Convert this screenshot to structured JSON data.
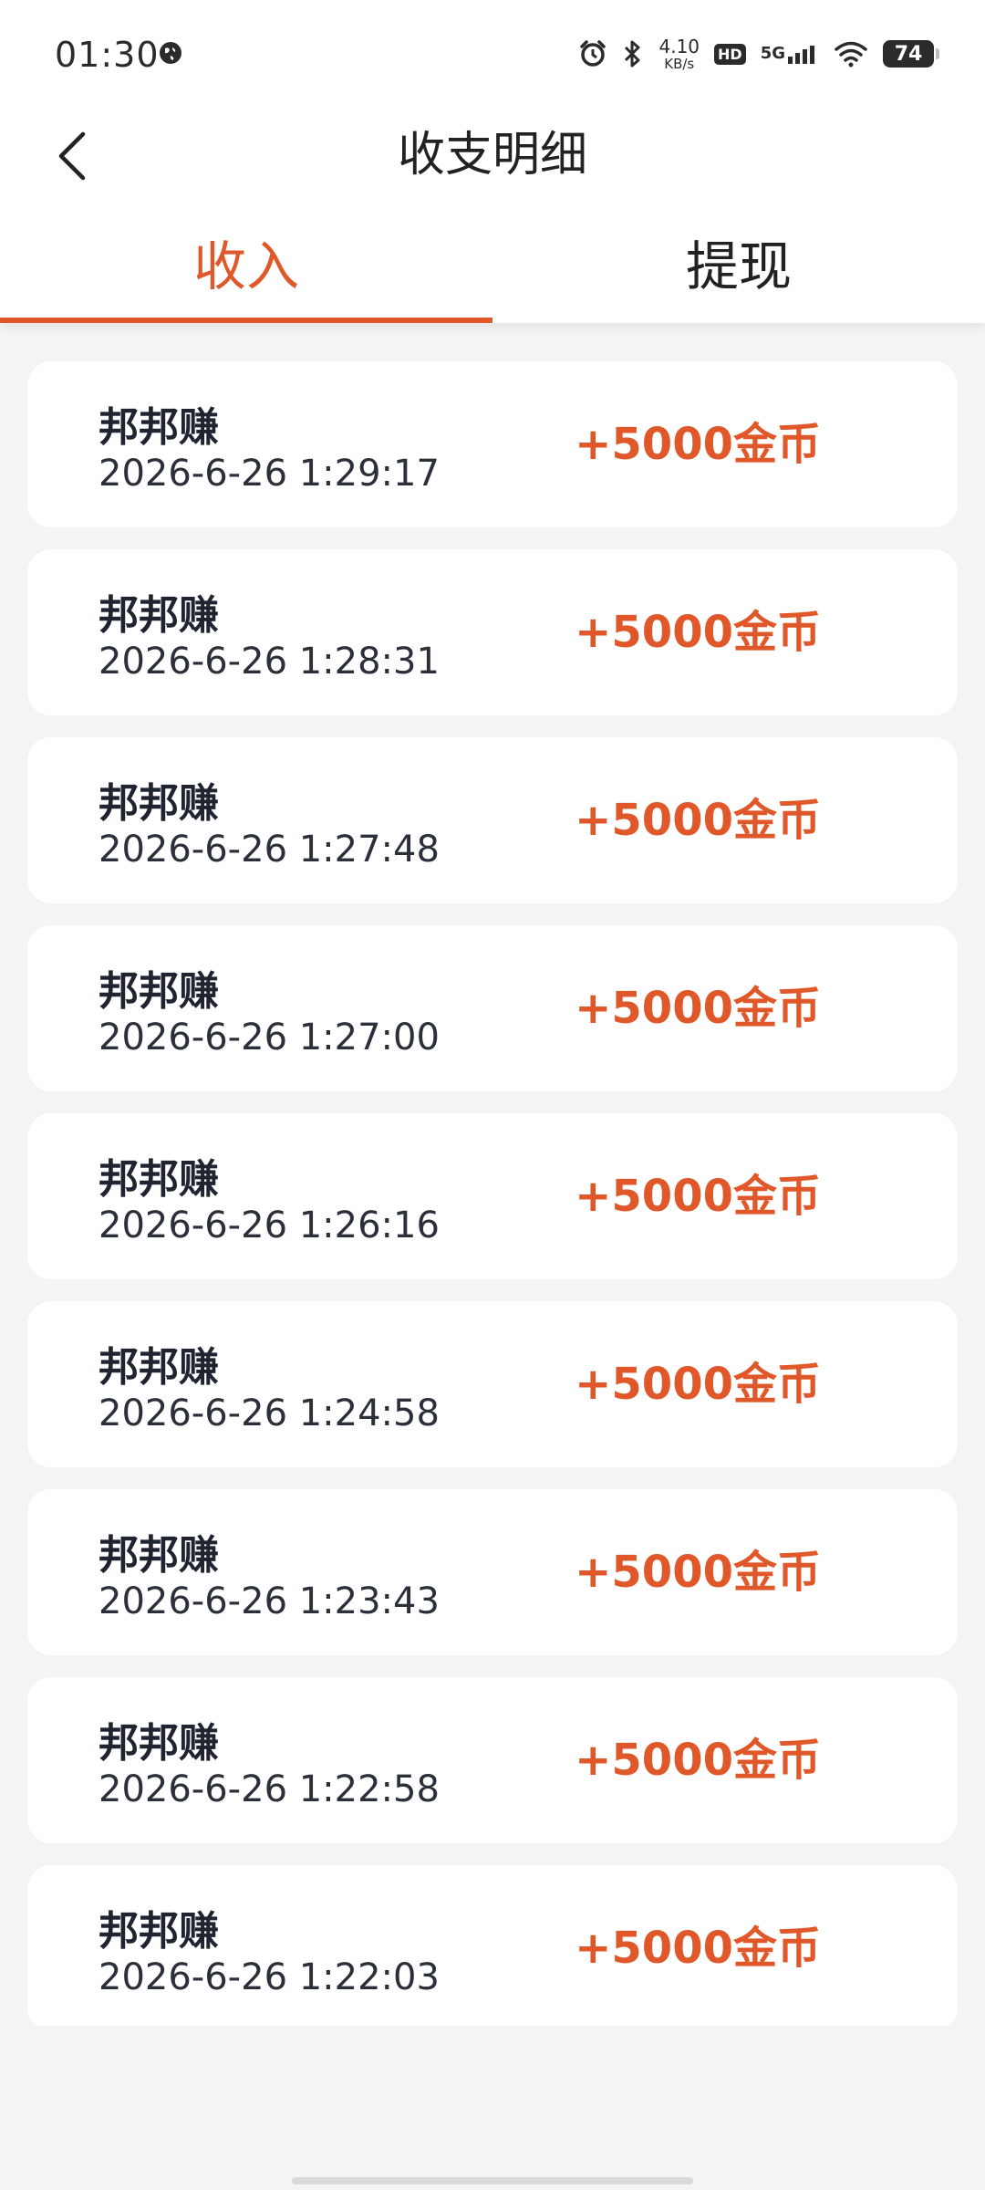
{
  "status_bar": {
    "time": "01:30",
    "net_speed_value": "4.10",
    "net_speed_unit": "KB/s",
    "hd_label": "HD",
    "network_label": "5G",
    "battery": "74",
    "icons": [
      "globe-icon",
      "alarm-icon",
      "bluetooth-icon",
      "signal-icon",
      "wifi-icon",
      "battery-icon"
    ]
  },
  "header": {
    "title": "收支明细",
    "back_icon": "chevron-left-icon"
  },
  "tabs": [
    {
      "label": "收入",
      "active": true
    },
    {
      "label": "提现",
      "active": false
    }
  ],
  "colors": {
    "accent": "#e0582a",
    "background": "#f4f4f4",
    "card": "#ffffff",
    "text": "#1f2430"
  },
  "records": [
    {
      "source": "邦邦赚",
      "time": "2026-6-26 1:29:17",
      "amount": "+5000金币"
    },
    {
      "source": "邦邦赚",
      "time": "2026-6-26 1:28:31",
      "amount": "+5000金币"
    },
    {
      "source": "邦邦赚",
      "time": "2026-6-26 1:27:48",
      "amount": "+5000金币"
    },
    {
      "source": "邦邦赚",
      "time": "2026-6-26 1:27:00",
      "amount": "+5000金币"
    },
    {
      "source": "邦邦赚",
      "time": "2026-6-26 1:26:16",
      "amount": "+5000金币"
    },
    {
      "source": "邦邦赚",
      "time": "2026-6-26 1:24:58",
      "amount": "+5000金币"
    },
    {
      "source": "邦邦赚",
      "time": "2026-6-26 1:23:43",
      "amount": "+5000金币"
    },
    {
      "source": "邦邦赚",
      "time": "2026-6-26 1:22:58",
      "amount": "+5000金币"
    },
    {
      "source": "邦邦赚",
      "time": "2026-6-26 1:22:03",
      "amount": "+5000金币"
    }
  ]
}
